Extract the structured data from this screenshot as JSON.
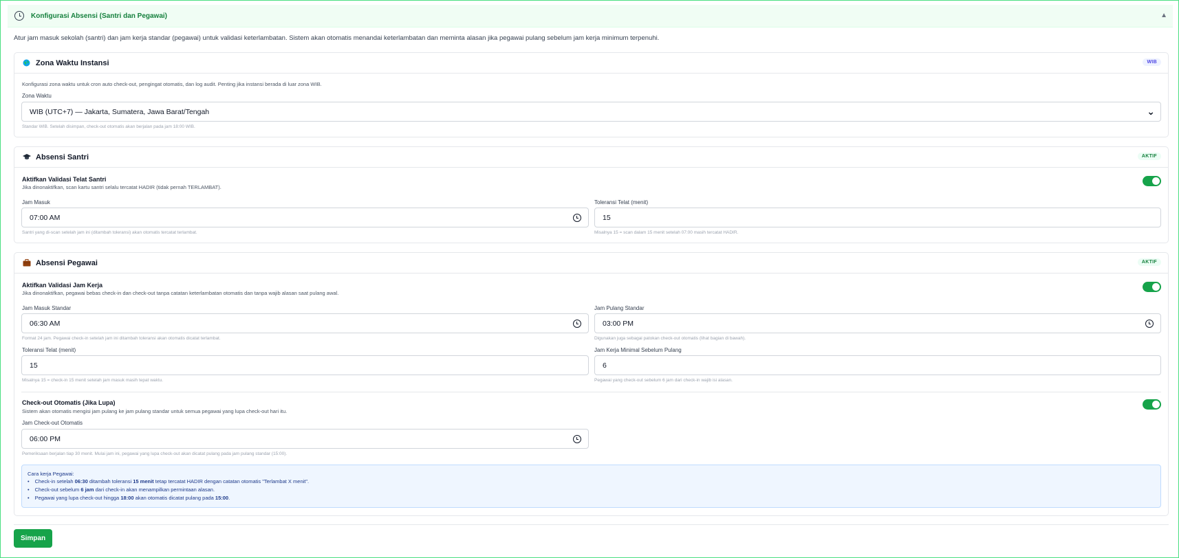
{
  "header": {
    "title": "Konfigurasi Absensi (Santri dan Pegawai)",
    "collapse_icon": "caret-up-icon"
  },
  "intro": "Atur jam masuk sekolah (santri) dan jam kerja standar (pegawai) untuk validasi keterlambatan. Sistem akan otomatis menandai keterlambatan dan meminta alasan jika pegawai pulang sebelum jam kerja minimum terpenuhi.",
  "timezone": {
    "title": "Zona Waktu Instansi",
    "badge": "WIB",
    "description": "Konfigurasi zona waktu untuk cron auto check-out, pengingat otomatis, dan log audit. Penting jika instansi berada di luar zona WIB.",
    "field_label": "Zona Waktu",
    "selected": "WIB (UTC+7) — Jakarta, Sumatera, Jawa Barat/Tengah",
    "hint": "Standar WIB. Setelah disimpan, check-out otomatis akan berjalan pada jam 18:00 WIB."
  },
  "santri": {
    "title": "Absensi Santri",
    "badge": "AKTIF",
    "toggle_label": "Aktifkan Validasi Telat Santri",
    "toggle_desc": "Jika dinonaktifkan, scan kartu santri selalu tercatat HADIR (tidak pernah TERLAMBAT).",
    "toggle_on": true,
    "jam_masuk_label": "Jam Masuk",
    "jam_masuk_value": "07:00  AM",
    "jam_masuk_hint": "Santri yang di-scan setelah jam ini (ditambah toleransi) akan otomatis tercatat terlambat.",
    "toleransi_label": "Toleransi Telat (menit)",
    "toleransi_value": "15",
    "toleransi_hint": "Misalnya 15 = scan dalam 15 menit setelah 07:00 masih tercatat HADIR."
  },
  "pegawai": {
    "title": "Absensi Pegawai",
    "badge": "AKTIF",
    "toggle_label": "Aktifkan Validasi Jam Kerja",
    "toggle_desc": "Jika dinonaktifkan, pegawai bebas check-in dan check-out tanpa catatan keterlambatan otomatis dan tanpa wajib alasan saat pulang awal.",
    "toggle_on": true,
    "jam_masuk_label": "Jam Masuk Standar",
    "jam_masuk_value": "06:30  AM",
    "jam_masuk_hint": "Format 24 jam. Pegawai check-in setelah jam ini ditambah toleransi akan otomatis dicatat terlambat.",
    "jam_pulang_label": "Jam Pulang Standar",
    "jam_pulang_value": "03:00  PM",
    "jam_pulang_hint": "Digunakan juga sebagai patokan check-out otomatis (lihat bagian di bawah).",
    "toleransi_label": "Toleransi Telat (menit)",
    "toleransi_value": "15",
    "toleransi_hint": "Misalnya 15 = check-in 15 menit setelah jam masuk masih tepat waktu.",
    "minimal_label": "Jam Kerja Minimal Sebelum Pulang",
    "minimal_value": "6",
    "minimal_hint": "Pegawai yang check-out sebelum 6 jam dari check-in wajib isi alasan.",
    "auto_label": "Check-out Otomatis (Jika Lupa)",
    "auto_desc": "Sistem akan otomatis mengisi jam pulang ke jam pulang standar untuk semua pegawai yang lupa check-out hari itu.",
    "auto_on": true,
    "auto_time_label": "Jam Check-out Otomatis",
    "auto_time_value": "06:00  PM",
    "auto_time_hint": "Pemeriksaan berjalan tiap 30 menit. Mulai jam ini, pegawai yang lupa check-out akan dicatat pulang pada jam pulang standar (15:00).",
    "info": {
      "title": "Cara kerja Pegawai:",
      "l1a": "Check-in setelah ",
      "l1b": "06:30",
      "l1c": " ditambah toleransi ",
      "l1d": "15 menit",
      "l1e": " tetap tercatat HADIR dengan catatan otomatis \"Terlambat X menit\".",
      "l2a": "Check-out sebelum ",
      "l2b": "6 jam",
      "l2c": " dari check-in akan menampilkan permintaan alasan.",
      "l3a": "Pegawai yang lupa check-out hingga ",
      "l3b": "18:00",
      "l3c": " akan otomatis dicatat pulang pada ",
      "l3d": "15:00",
      "l3e": "."
    }
  },
  "save_label": "Simpan",
  "colors": {
    "accent": "#16a34a",
    "header_bg": "#f0fdf4",
    "info_bg": "#eff6ff"
  }
}
